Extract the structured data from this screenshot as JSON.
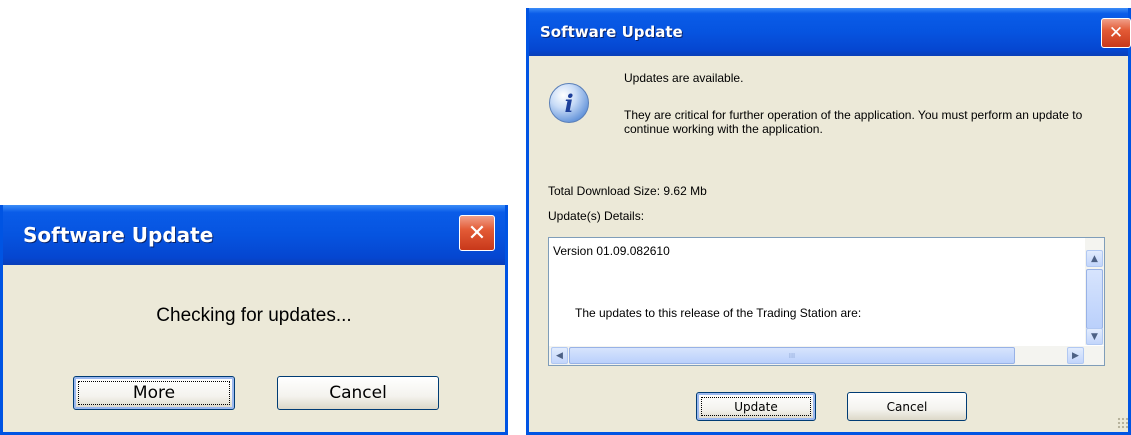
{
  "dialog_checking": {
    "title": "Software Update",
    "message": "Checking for updates...",
    "more_label": "More",
    "cancel_label": "Cancel",
    "close_glyph": "✕"
  },
  "dialog_update": {
    "title": "Software Update",
    "close_glyph": "✕",
    "info_icon_glyph": "i",
    "available_text": "Updates are available.",
    "critical_text": "They are critical for further operation of the application. You must perform an update to continue working with the application.",
    "download_size": "Total Download Size: 9.62 Mb",
    "details_label": "Update(s) Details:",
    "details_lines": [
      "Version 01.09.082610",
      "The updates to this release of the Trading Station are:"
    ],
    "scroll_up_glyph": "▲",
    "scroll_down_glyph": "▼",
    "scroll_left_glyph": "◀",
    "scroll_right_glyph": "▶",
    "thumb_grip": "III",
    "update_label": "Update",
    "cancel_label": "Cancel"
  },
  "icons": {
    "close": "close-icon",
    "info": "info-icon",
    "scroll_up": "arrow-up-icon",
    "scroll_down": "arrow-down-icon",
    "scroll_left": "arrow-left-icon",
    "scroll_right": "arrow-right-icon"
  },
  "colors": {
    "titlebar_blue": "#0654e0",
    "dialog_bg": "#ece9d8",
    "close_red": "#e35b36"
  }
}
